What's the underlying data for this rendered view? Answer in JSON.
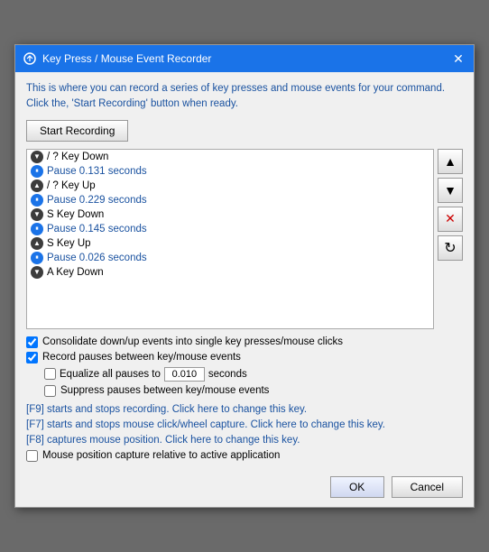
{
  "window": {
    "title": "Key Press / Mouse Event Recorder",
    "close_label": "✕"
  },
  "intro": {
    "text": "This is where you can record a series of key presses and mouse events for your command. Click the, 'Start Recording' button when ready."
  },
  "toolbar": {
    "start_recording_label": "Start Recording"
  },
  "events": [
    {
      "type": "key_down",
      "label": "/ ? Key Down"
    },
    {
      "type": "pause",
      "label": "Pause 0.131 seconds"
    },
    {
      "type": "key_up",
      "label": "/ ? Key Up"
    },
    {
      "type": "pause",
      "label": "Pause 0.229 seconds"
    },
    {
      "type": "key_down",
      "label": "S Key Down"
    },
    {
      "type": "pause",
      "label": "Pause 0.145 seconds"
    },
    {
      "type": "key_up",
      "label": "S Key Up"
    },
    {
      "type": "pause",
      "label": "Pause 0.026 seconds"
    },
    {
      "type": "key_down",
      "label": "A Key Down"
    }
  ],
  "list_buttons": {
    "up": "▲",
    "down": "▼",
    "delete": "✕",
    "refresh": "↻"
  },
  "options": {
    "consolidate_label": "Consolidate down/up events into single key presses/mouse clicks",
    "record_pauses_label": "Record pauses between key/mouse events",
    "equalize_label": "Equalize all pauses to",
    "equalize_value": "0.010",
    "equalize_unit": "seconds",
    "suppress_label": "Suppress pauses between key/mouse events",
    "consolidate_checked": true,
    "record_pauses_checked": true,
    "equalize_checked": false,
    "suppress_checked": false
  },
  "links": {
    "f9_text": "[F9] starts and stops recording.  Click here to change this key.",
    "f7_text": "[F7] starts and stops mouse click/wheel capture.  Click here to change this key.",
    "f8_text": "[F8] captures mouse position.  Click here to change this key."
  },
  "mouse_position": {
    "label": "Mouse position capture relative to active application",
    "checked": false
  },
  "footer": {
    "ok_label": "OK",
    "cancel_label": "Cancel"
  }
}
